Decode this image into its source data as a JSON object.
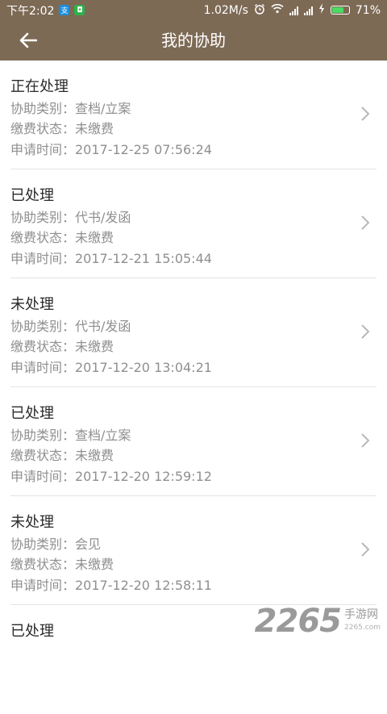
{
  "status_bar": {
    "time": "下午2:02",
    "speed": "1.02M/s",
    "battery": "71%",
    "battery_level": 0.71,
    "icons": [
      "alipay-icon",
      "wechat-icon",
      "alarm-icon",
      "wifi-icon",
      "signal-icon",
      "signal-icon",
      "charging-icon",
      "battery-icon"
    ]
  },
  "header": {
    "title": "我的协助",
    "back_icon": "arrow-left-icon"
  },
  "requests": [
    {
      "status": "正在处理",
      "category": "协助类别：查档/立案",
      "payment": "缴费状态：未缴费",
      "time": "申请时间：2017-12-25 07:56:24"
    },
    {
      "status": "已处理",
      "category": "协助类别：代书/发函",
      "payment": "缴费状态：未缴费",
      "time": "申请时间：2017-12-21 15:05:44"
    },
    {
      "status": "未处理",
      "category": "协助类别：代书/发函",
      "payment": "缴费状态：未缴费",
      "time": "申请时间：2017-12-20 13:04:21"
    },
    {
      "status": "已处理",
      "category": "协助类别：查档/立案",
      "payment": "缴费状态：未缴费",
      "time": "申请时间：2017-12-20 12:59:12"
    },
    {
      "status": "未处理",
      "category": "协助类别：会见",
      "payment": "缴费状态：未缴费",
      "time": "申请时间：2017-12-20 12:58:11"
    },
    {
      "status": "已处理"
    }
  ],
  "watermark": {
    "number": "2265",
    "text": "手游网",
    "sub": "2265.com"
  },
  "colors": {
    "header_bg": "#7d6a55",
    "divider": "#e3e3e3",
    "secondary_text": "#8f8f8f"
  }
}
